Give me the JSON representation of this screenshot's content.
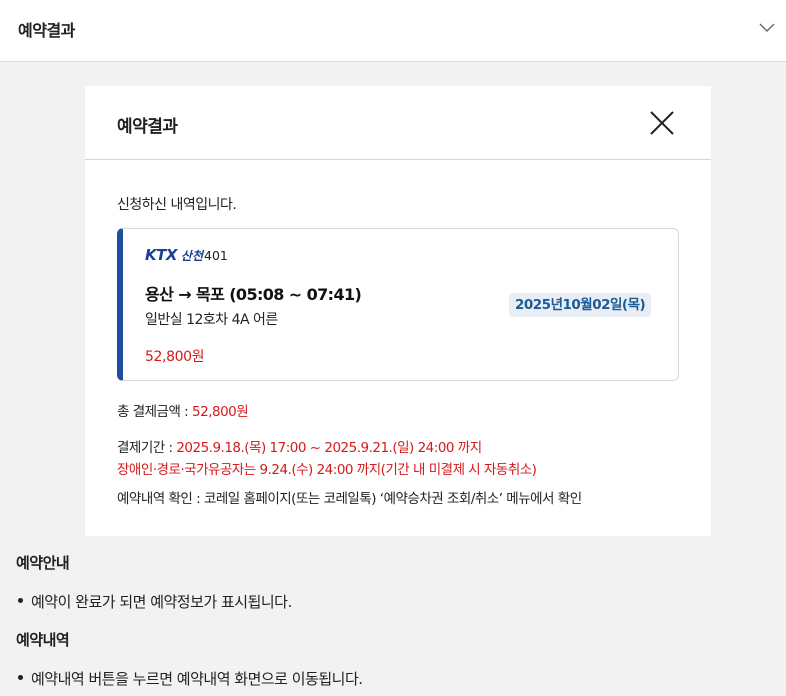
{
  "header": {
    "title": "예약결과",
    "toggle_icon": "chevron-down-icon"
  },
  "modal": {
    "title": "예약결과",
    "close_icon": "close-icon",
    "intro": "신청하신 내역입니다.",
    "ticket": {
      "train_brand": "KTX",
      "train_line": "산천",
      "train_number": "401",
      "route": "용산 → 목포 (05:08 ~ 07:41)",
      "seat": "일반실 12호차 4A 어른",
      "price": "52,800원",
      "date": "2025년10월02일(목)"
    },
    "total": {
      "label": "총 결제금액 : ",
      "value": "52,800원"
    },
    "deadline": {
      "label": "결제기간 : ",
      "value": "2025.9.18.(목) 17:00 ~ 2025.9.21.(일) 24:00 까지",
      "special": "장애인·경로·국가유공자는 9.24.(수) 24:00 까지(기간 내 미결제 시 자동취소)"
    },
    "confirm": "예약내역 확인 : 코레일 홈페이지(또는 코레일톡) ‘예약승차권 조회/취소’ 메뉴에서 확인"
  },
  "guide": {
    "section1_title": "예약안내",
    "section1_text": "예약이 완료가 되면 예약정보가 표시됩니다.",
    "section2_title": "예약내역",
    "section2_text": "예약내역 버튼을 누르면 예약내역 화면으로 이동됩니다."
  },
  "colors": {
    "accent_blue": "#1e4f9e",
    "price_red": "#d51a1a",
    "badge_bg": "#e9eef5"
  }
}
